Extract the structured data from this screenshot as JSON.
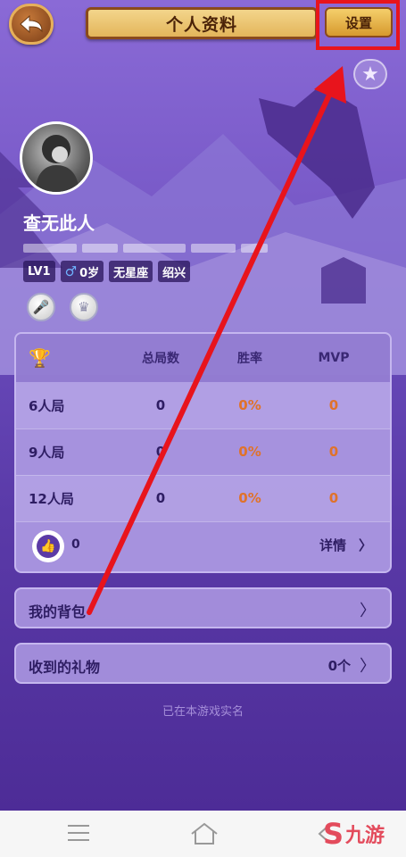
{
  "header": {
    "title": "个人资料",
    "settings_label": "设置"
  },
  "profile": {
    "username": "查无此人",
    "tags": {
      "level": "LV1",
      "gender_icon": "♂",
      "age": "0岁",
      "zodiac": "无星座",
      "city": "绍兴"
    }
  },
  "stats": {
    "columns": [
      "总局数",
      "胜率",
      "MVP"
    ],
    "rows": [
      {
        "label": "6人局",
        "total": "0",
        "win_rate": "0%",
        "mvp": "0"
      },
      {
        "label": "9人局",
        "total": "0",
        "win_rate": "0%",
        "mvp": "0"
      },
      {
        "label": "12人局",
        "total": "0",
        "win_rate": "0%",
        "mvp": "0"
      }
    ],
    "likes": "0",
    "detail_label": "详情"
  },
  "menu": {
    "bag_label": "我的背包",
    "gifts_label": "收到的礼物",
    "gifts_count": "0个"
  },
  "verified_text": "已在本游戏实名",
  "watermark": {
    "icon": "S",
    "text": "九游"
  },
  "colors": {
    "accent_orange": "#e0722a",
    "annotation_red": "#e8141c",
    "brand_gold": "#e3b55b"
  }
}
